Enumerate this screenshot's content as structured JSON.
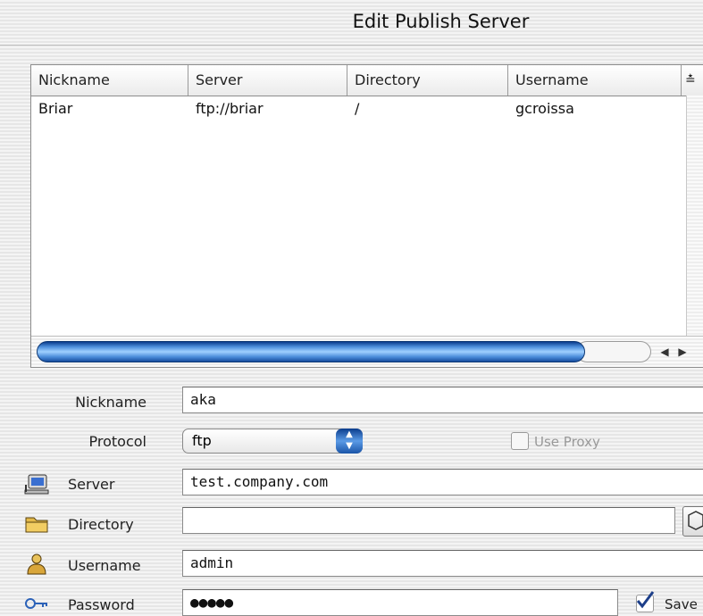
{
  "window": {
    "title": "Edit Publish Server"
  },
  "table": {
    "columns": [
      "Nickname",
      "Server",
      "Directory",
      "Username"
    ],
    "rows": [
      {
        "nickname": "Briar",
        "server": "ftp://briar",
        "directory": "/",
        "username": "gcroissa"
      }
    ]
  },
  "form": {
    "nickname_label": "Nickname",
    "nickname_value": "aka",
    "protocol_label": "Protocol",
    "protocol_value": "ftp",
    "use_proxy_label": "Use Proxy",
    "server_label": "Server",
    "server_value": "test.company.com",
    "directory_label": "Directory",
    "directory_value": "",
    "username_label": "Username",
    "username_value": "admin",
    "password_label": "Password",
    "password_value": "●●●●●",
    "save_label": "Save",
    "save_checked": true
  },
  "icons": {
    "server": "computer-icon",
    "directory": "folder-icon",
    "username": "user-icon",
    "password": "key-icon"
  },
  "colors": {
    "accent": "#3a7fd6",
    "window": "#ececec"
  }
}
